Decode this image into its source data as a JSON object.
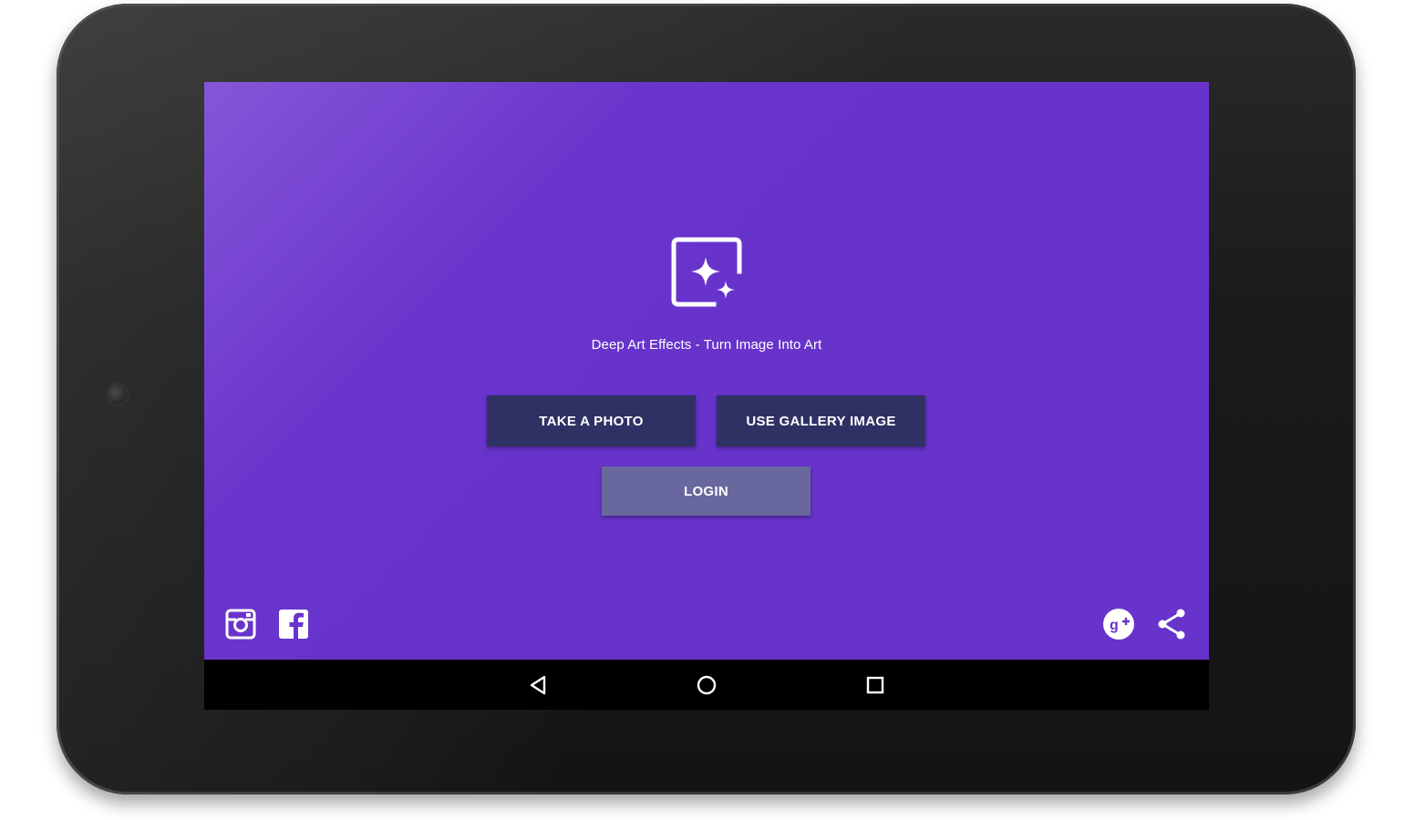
{
  "app": {
    "title": "Deep Art Effects - Turn Image Into Art",
    "colors": {
      "background": "#6733cb",
      "primary_button": "#2f3164",
      "secondary_button": "#68679e",
      "text": "#ffffff"
    },
    "logo_icon": "sparkle-image-icon"
  },
  "buttons": {
    "take_photo": "TAKE A PHOTO",
    "use_gallery": "USE GALLERY IMAGE",
    "login": "LOGIN"
  },
  "social": {
    "left": [
      "instagram-icon",
      "facebook-icon"
    ],
    "right": [
      "google-plus-icon",
      "share-icon"
    ]
  },
  "navbar": {
    "items": [
      "back-icon",
      "home-icon",
      "recents-icon"
    ]
  }
}
